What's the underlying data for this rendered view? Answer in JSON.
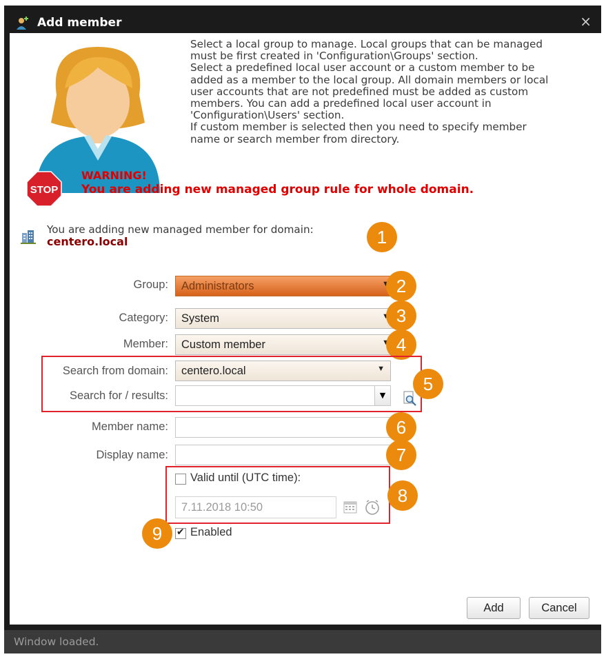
{
  "window": {
    "title": "Add member",
    "close_glyph": "×"
  },
  "info": {
    "lines": [
      "Select a local group to manage. Local groups that can be managed",
      "must be first created in 'Configuration\\Groups' section.",
      "Select a predefined local user account or a custom member to be",
      "added as a member to the local group. All domain members or local",
      "user accounts that are not predefined must be added as custom",
      "members. You can add a predefined local user account in",
      "'Configuration\\Users' section.",
      "If custom member is selected then you need to specify member",
      "name or search member from directory."
    ]
  },
  "warning": {
    "title": "WARNING!",
    "message": "You are adding new managed group rule for whole domain."
  },
  "stop_sign": {
    "text": "STOP"
  },
  "domain": {
    "label": "You are adding new managed member for domain:",
    "value": "centero.local"
  },
  "form": {
    "group": {
      "label": "Group:",
      "value": "Administrators"
    },
    "category": {
      "label": "Category:",
      "value": "System"
    },
    "member": {
      "label": "Member:",
      "value": "Custom member"
    },
    "search_domain": {
      "label": "Search from domain:",
      "value": "centero.local"
    },
    "search_for": {
      "label": "Search for / results:",
      "value": ""
    },
    "member_name": {
      "label": "Member name:",
      "value": ""
    },
    "display_name": {
      "label": "Display name:",
      "value": ""
    },
    "valid_until": {
      "label": "Valid until (UTC time):",
      "checked": false,
      "value": "7.11.2018 10:50"
    },
    "enabled": {
      "label": "Enabled",
      "checked": true
    }
  },
  "callouts": [
    "1",
    "2",
    "3",
    "4",
    "5",
    "6",
    "7",
    "8",
    "9"
  ],
  "buttons": {
    "add": "Add",
    "cancel": "Cancel"
  },
  "status": {
    "text": "Window loaded."
  },
  "icons": [
    "user-avatar-icon",
    "stop-sign-icon",
    "domain-icon",
    "dropdown-arrow-icon",
    "search-icon",
    "calendar-icon",
    "clock-icon",
    "close-icon"
  ],
  "colors": {
    "accent_orange": "#ec8a0e",
    "warning_red": "#e00000",
    "domain_red": "#8a0000",
    "highlight_box": "#e3212b",
    "title_bg": "#1b1b1b"
  }
}
